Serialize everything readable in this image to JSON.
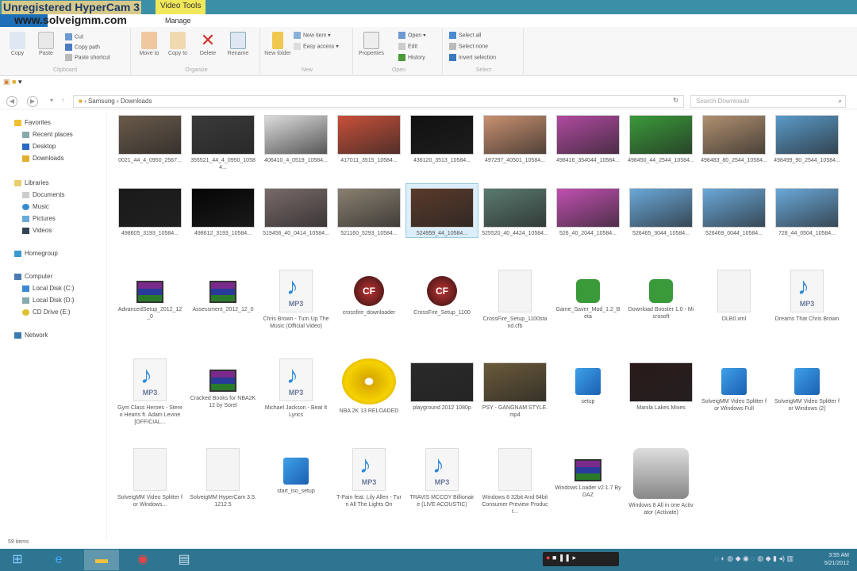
{
  "watermark": "Unregistered HyperCam 3",
  "watermark_url": "www.solveigmm.com",
  "context_tab": "Video Tools",
  "manage_tab": "Manage",
  "ribbon": {
    "clipboard": {
      "label": "Clipboard",
      "copy": "Copy",
      "paste": "Paste",
      "cut": "Cut",
      "copy_path": "Copy path",
      "paste_shortcut": "Paste shortcut"
    },
    "organize": {
      "label": "Organize",
      "move_to": "Move to",
      "copy_to": "Copy to",
      "delete": "Delete",
      "rename": "Rename"
    },
    "new": {
      "label": "New",
      "new_folder": "New folder",
      "new_item": "New item",
      "easy_access": "Easy access"
    },
    "open": {
      "label": "Open",
      "properties": "Properties",
      "open": "Open",
      "edit": "Edit",
      "history": "History"
    },
    "select": {
      "label": "Select",
      "select_all": "Select all",
      "select_none": "Select none",
      "invert": "Invert selection"
    }
  },
  "address": {
    "path": [
      "Samsung",
      "Downloads"
    ],
    "search_placeholder": "Search Downloads"
  },
  "nav": {
    "favorites": "Favorites",
    "favorites_items": [
      "Recent places",
      "Desktop",
      "Downloads"
    ],
    "libraries": "Libraries",
    "libraries_items": [
      "Documents",
      "Music",
      "Pictures",
      "Videos"
    ],
    "homegroup": "Homegroup",
    "computer": "Computer",
    "computer_items": [
      "Local Disk (C:)",
      "Local Disk (D:)",
      "CD Drive (E:)"
    ],
    "network": "Network"
  },
  "files": [
    {
      "name": "0021_44_4_0950_2567...",
      "icon": "thumb",
      "color": "#6a5a4a"
    },
    {
      "name": "355521_44_4_0950_10584...",
      "icon": "thumb",
      "color": "#3a3a3a"
    },
    {
      "name": "406410_4_0519_10584...",
      "icon": "thumb",
      "color": "#dcdcdc"
    },
    {
      "name": "417011_3515_10584...",
      "icon": "thumb",
      "color": "#c8503a"
    },
    {
      "name": "436120_3513_10584...",
      "icon": "thumb",
      "color": "#111111"
    },
    {
      "name": "497297_40501_10584...",
      "icon": "thumb",
      "color": "#c89070"
    },
    {
      "name": "498416_354044_10584...",
      "icon": "thumb",
      "color": "#b04aa0"
    },
    {
      "name": "498450_44_2544_10584...",
      "icon": "thumb",
      "color": "#3a9a3a"
    },
    {
      "name": "498483_80_2544_10584...",
      "icon": "thumb",
      "color": "#b09070"
    },
    {
      "name": "498499_90_2544_10584...",
      "icon": "thumb",
      "color": "#5a9ac8"
    },
    {
      "name": "498605_3193_10584...",
      "icon": "thumb",
      "color": "#1a1a1a"
    },
    {
      "name": "498612_3193_10584...",
      "icon": "thumb",
      "color": "#050505"
    },
    {
      "name": "519456_40_0414_10584...",
      "icon": "thumb",
      "color": "#7a6a6a"
    },
    {
      "name": "521160_5293_10584...",
      "icon": "thumb",
      "color": "#8a8070"
    },
    {
      "name": "524959_44_10584...",
      "icon": "thumb",
      "color": "#5a3a2a"
    },
    {
      "name": "525520_40_4424_10584...",
      "icon": "thumb",
      "color": "#5a7a70"
    },
    {
      "name": "526_40_2044_10584...",
      "icon": "thumb",
      "color": "#c050b0"
    },
    {
      "name": "526465_3044_10584...",
      "icon": "thumb",
      "color": "#6aa8d8"
    },
    {
      "name": "526469_0044_10584...",
      "icon": "thumb",
      "color": "#6aa8d8"
    },
    {
      "name": "728_44_0504_10584...",
      "icon": "thumb",
      "color": "#6aa8d8"
    },
    {
      "name": "AdvancedSetup_2012_12_0",
      "icon": "rar"
    },
    {
      "name": "Assessment_2012_12_0",
      "icon": "rar"
    },
    {
      "name": "Chris Brown - Turn Up The Music (Official Video)",
      "icon": "mp3"
    },
    {
      "name": "crossfire_downloader",
      "icon": "cf"
    },
    {
      "name": "CrossFire_Setup_1100",
      "icon": "cf"
    },
    {
      "name": "CrossFire_Setup_1100stand.cfb",
      "icon": "doc"
    },
    {
      "name": "Game_Saver_Mod_1.2_Beta",
      "icon": "exe"
    },
    {
      "name": "Download Booster 1.0 - Microsoft",
      "icon": "exe"
    },
    {
      "name": "DLB0.xml",
      "icon": "doc"
    },
    {
      "name": "Dreams That Chris Brown",
      "icon": "mp3"
    },
    {
      "name": "Gym Class Heroes - Stereo Hearts ft. Adam Levine [OFFICIAL...",
      "icon": "mp3"
    },
    {
      "name": "Cracked Books for NBA2K12 by Sorel",
      "icon": "rar"
    },
    {
      "name": "Michael Jackson - Beat It Lyrics",
      "icon": "mp3"
    },
    {
      "name": "NBA 2K 13 RELOADED",
      "icon": "cd"
    },
    {
      "name": "playground 2012 1080p",
      "icon": "thumb",
      "color": "#2a2a2a"
    },
    {
      "name": "PSY - GANGNAM STYLE.mp4",
      "icon": "thumb",
      "color": "#6a5a3a"
    },
    {
      "name": "setup",
      "icon": "setup"
    },
    {
      "name": "Manila Lakes Mixes",
      "icon": "thumb",
      "color": "#2a1a1a"
    },
    {
      "name": "SolveigMM Video Splitter for Windows Full",
      "icon": "setup"
    },
    {
      "name": "SolveigMM Video Splitter for Windows (2)",
      "icon": "setup"
    },
    {
      "name": "SolveigMM Video Splitter for Windows...",
      "icon": "doc"
    },
    {
      "name": "SolveigMM HyperCam 3.5.1212.5",
      "icon": "doc"
    },
    {
      "name": "start_iso_setup",
      "icon": "setup"
    },
    {
      "name": "T-Pain feat. Lily Allen - Turn All The Lights On",
      "icon": "mp3"
    },
    {
      "name": "TRAVIS MCCOY Billionaire (LIVE ACOUSTIC)",
      "icon": "mp3"
    },
    {
      "name": "Windows 8 32bit And 64bit Consumer Preview Product...",
      "icon": "doc"
    },
    {
      "name": "Windows Loader v2.1.7 By DAZ",
      "icon": "rar"
    },
    {
      "name": "Windows 8 All in one Activator (Activate)",
      "icon": "lock"
    }
  ],
  "status": {
    "item_count": "59 items"
  },
  "taskbar": {
    "apps": [
      "Internet Explorer",
      "File Explorer",
      "Google Chrome",
      "Notepad"
    ],
    "time": "3:55 AM",
    "date": "5/21/2012"
  }
}
